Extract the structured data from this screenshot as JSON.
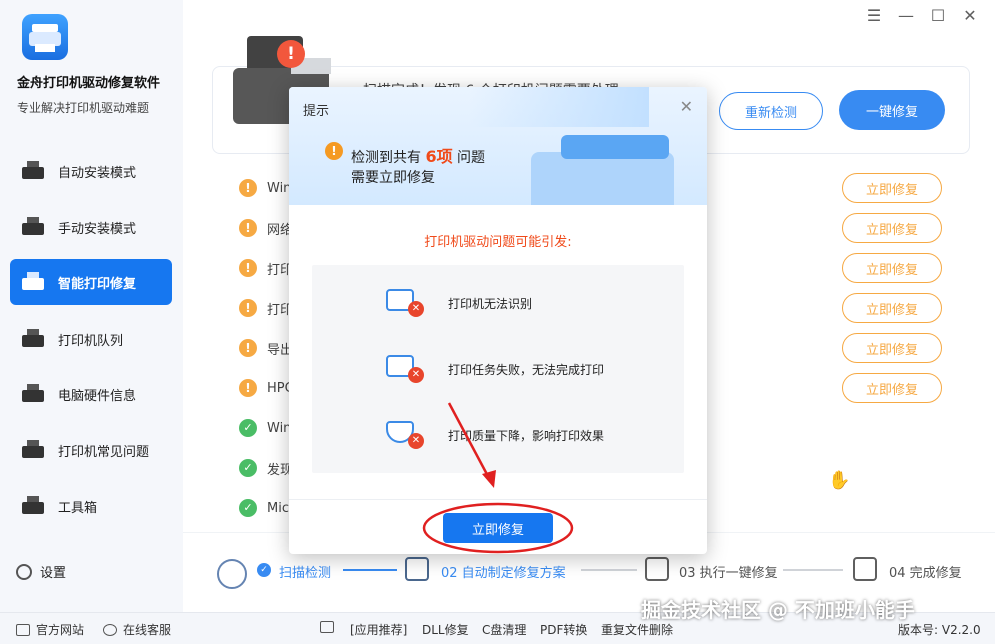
{
  "sidebar": {
    "app_title": "金舟打印机驱动修复软件",
    "app_subtitle": "专业解决打印机驱动难题",
    "items": [
      {
        "label": "自动安装模式",
        "active": false
      },
      {
        "label": "手动安装模式",
        "active": false
      },
      {
        "label": "智能打印修复",
        "active": true
      },
      {
        "label": "打印机队列",
        "active": false
      },
      {
        "label": "电脑硬件信息",
        "active": false
      },
      {
        "label": "打印机常见问题",
        "active": false
      },
      {
        "label": "工具箱",
        "active": false
      }
    ],
    "settings_label": "设置"
  },
  "window_controls": [
    "☰",
    "—",
    "☐",
    "✕"
  ],
  "top_card": {
    "scan_text": "扫描完成！发现 6 个打印机问题需要处理",
    "recheck_label": "重新检测",
    "fix_all_label": "一键修复"
  },
  "issues": [
    {
      "status": "warn",
      "text": "Win",
      "fix_label": "立即修复"
    },
    {
      "status": "warn",
      "text": "网络",
      "fix_label": "立即修复"
    },
    {
      "status": "warn",
      "text": "打印",
      "fix_label": "立即修复"
    },
    {
      "status": "warn",
      "text": "打印",
      "fix_label": "立即修复"
    },
    {
      "status": "warn",
      "text": "导出",
      "fix_label": "立即修复"
    },
    {
      "status": "warn",
      "text": "HPC",
      "fix_label": "立即修复"
    },
    {
      "status": "ok",
      "text": "Win"
    },
    {
      "status": "ok",
      "text": "发现"
    },
    {
      "status": "ok",
      "text": "Mic"
    }
  ],
  "steps": [
    {
      "label": "扫描检测",
      "state": "done"
    },
    {
      "label": "02 自动制定修复方案",
      "state": "current"
    },
    {
      "label": "03 执行一键修复",
      "state": "todo"
    },
    {
      "label": "04 完成修复",
      "state": "todo"
    }
  ],
  "statusbar": {
    "website": "官方网站",
    "service": "在线客服",
    "promo": "[应用推荐]",
    "links": [
      "DLL修复",
      "C盘清理",
      "PDF转换",
      "重复文件删除"
    ],
    "version": "版本号: V2.2.0"
  },
  "dialog": {
    "title": "提示",
    "close": "✕",
    "msg_prefix": "检测到共有",
    "count": "6项",
    "msg_suffix": "问题",
    "msg_line2": "需要立即修复",
    "cause_title": "打印机驱动问题可能引发:",
    "causes": [
      "打印机无法识别",
      "打印任务失败，无法完成打印",
      "打印质量下降，影响打印效果"
    ],
    "fix_label": "立即修复"
  },
  "watermark": "掘金技术社区 @ 不加班小能手",
  "colors": {
    "accent": "#1677f0",
    "warn": "#f59a23",
    "ok": "#2bb24c",
    "danger": "#f04a1a",
    "annotation": "#e02020"
  }
}
